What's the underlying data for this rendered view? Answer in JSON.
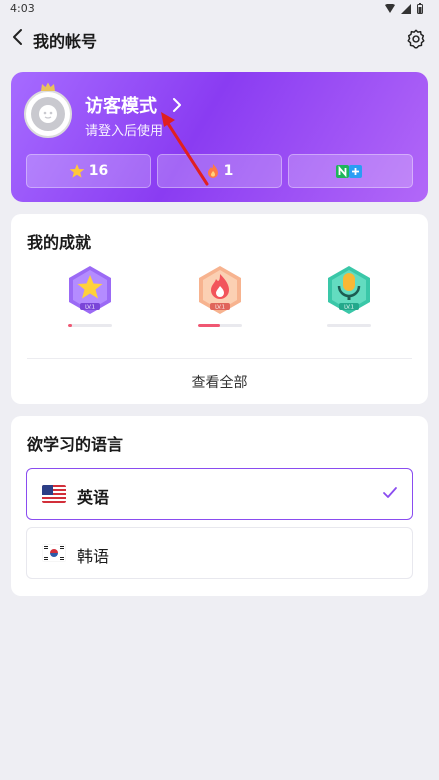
{
  "status_bar": {
    "time": "4:03"
  },
  "header": {
    "title": "我的帐号"
  },
  "profile": {
    "name": "访客模式",
    "subtitle": "请登入后使用",
    "stats": [
      {
        "icon": "star-icon",
        "value": "16"
      },
      {
        "icon": "flame-icon",
        "value": "1"
      },
      {
        "icon": "n-plus-icon",
        "value": ""
      }
    ]
  },
  "achievements": {
    "title": "我的成就",
    "badges": [
      {
        "name": "star-badge",
        "level": "LV.1",
        "progress": 0.08,
        "color": "#9b6af5"
      },
      {
        "name": "fire-badge",
        "level": "LV.1",
        "progress": 0.5,
        "color": "#f39a6e"
      },
      {
        "name": "mic-badge",
        "level": "LV.1",
        "progress": 0.0,
        "color": "#3ac7a8"
      }
    ],
    "view_all": "查看全部"
  },
  "languages": {
    "title": "欲学习的语言",
    "items": [
      {
        "label": "英语",
        "flag": "us-flag",
        "selected": true
      },
      {
        "label": "韩语",
        "flag": "kr-flag",
        "selected": false
      }
    ]
  },
  "colors": {
    "accent": "#8a4cf0",
    "card_gradient_start": "#a66bff",
    "card_gradient_end": "#8a3cf2"
  }
}
